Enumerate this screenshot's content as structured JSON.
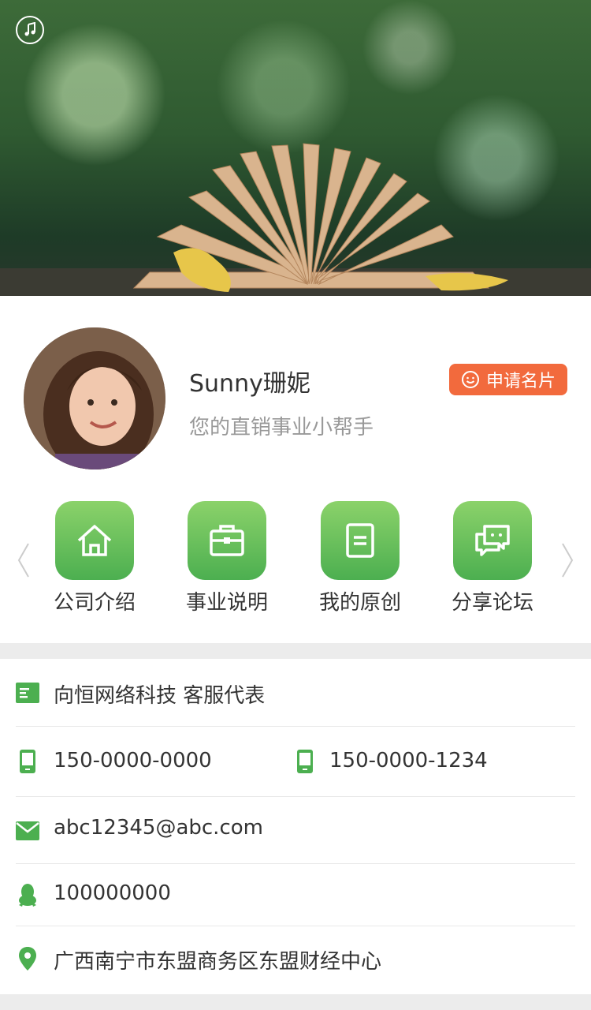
{
  "profile": {
    "name": "Sunny珊妮",
    "slogan": "您的直销事业小帮手",
    "apply_label": "申请名片"
  },
  "nav": [
    {
      "label": "公司介绍",
      "icon": "home-icon"
    },
    {
      "label": "事业说明",
      "icon": "briefcase-icon"
    },
    {
      "label": "我的原创",
      "icon": "document-icon"
    },
    {
      "label": "分享论坛",
      "icon": "chat-icon"
    }
  ],
  "contact": {
    "company": "向恒网络科技 客服代表",
    "phone1": "150-0000-0000",
    "phone2": "150-0000-1234",
    "email": "abc12345@abc.com",
    "qq": "100000000",
    "address": "广西南宁市东盟商务区东盟财经中心"
  },
  "colors": {
    "accent_green": "#4caf50",
    "accent_orange": "#f26a3d"
  }
}
